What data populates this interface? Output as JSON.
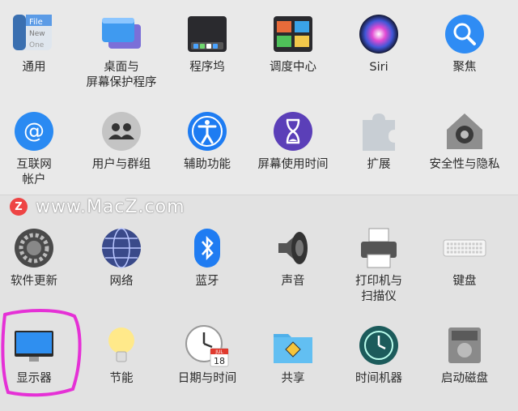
{
  "watermark": {
    "logo": "Z",
    "text": "www.MacZ.com"
  },
  "rows": [
    [
      {
        "id": "general",
        "label": "通用",
        "icon": "general-icon"
      },
      {
        "id": "desktop",
        "label": "桌面与\n屏幕保护程序",
        "icon": "desktop-screensaver-icon"
      },
      {
        "id": "dock",
        "label": "程序坞",
        "icon": "dock-icon"
      },
      {
        "id": "mission",
        "label": "调度中心",
        "icon": "mission-control-icon"
      },
      {
        "id": "siri",
        "label": "Siri",
        "icon": "siri-icon"
      },
      {
        "id": "spotlight",
        "label": "聚焦",
        "icon": "spotlight-icon"
      }
    ],
    [
      {
        "id": "internet",
        "label": "互联网\n帐户",
        "icon": "internet-accounts-icon"
      },
      {
        "id": "users",
        "label": "用户与群组",
        "icon": "users-groups-icon"
      },
      {
        "id": "access",
        "label": "辅助功能",
        "icon": "accessibility-icon"
      },
      {
        "id": "screentime",
        "label": "屏幕使用时间",
        "icon": "screen-time-icon"
      },
      {
        "id": "extensions",
        "label": "扩展",
        "icon": "extensions-icon"
      },
      {
        "id": "security",
        "label": "安全性与隐私",
        "icon": "security-privacy-icon"
      }
    ],
    [
      {
        "id": "update",
        "label": "软件更新",
        "icon": "software-update-icon"
      },
      {
        "id": "network",
        "label": "网络",
        "icon": "network-icon"
      },
      {
        "id": "bluetooth",
        "label": "蓝牙",
        "icon": "bluetooth-icon"
      },
      {
        "id": "sound",
        "label": "声音",
        "icon": "sound-icon"
      },
      {
        "id": "printers",
        "label": "打印机与\n扫描仪",
        "icon": "printers-scanners-icon"
      },
      {
        "id": "keyboard",
        "label": "键盘",
        "icon": "keyboard-icon"
      }
    ],
    [
      {
        "id": "displays",
        "label": "显示器",
        "icon": "displays-icon"
      },
      {
        "id": "energy",
        "label": "节能",
        "icon": "energy-saver-icon"
      },
      {
        "id": "datetime",
        "label": "日期与时间",
        "icon": "date-time-icon"
      },
      {
        "id": "sharing",
        "label": "共享",
        "icon": "sharing-icon"
      },
      {
        "id": "timemachine",
        "label": "时间机器",
        "icon": "time-machine-icon"
      },
      {
        "id": "startup",
        "label": "启动磁盘",
        "icon": "startup-disk-icon"
      }
    ]
  ],
  "icon_text": {
    "general_file": "File",
    "general_new": "New",
    "general_one": "One",
    "calendar_month": "JUL",
    "calendar_day": "18"
  },
  "colors": {
    "highlight": "#e531d6",
    "accent_blue": "#1e7cf2"
  }
}
